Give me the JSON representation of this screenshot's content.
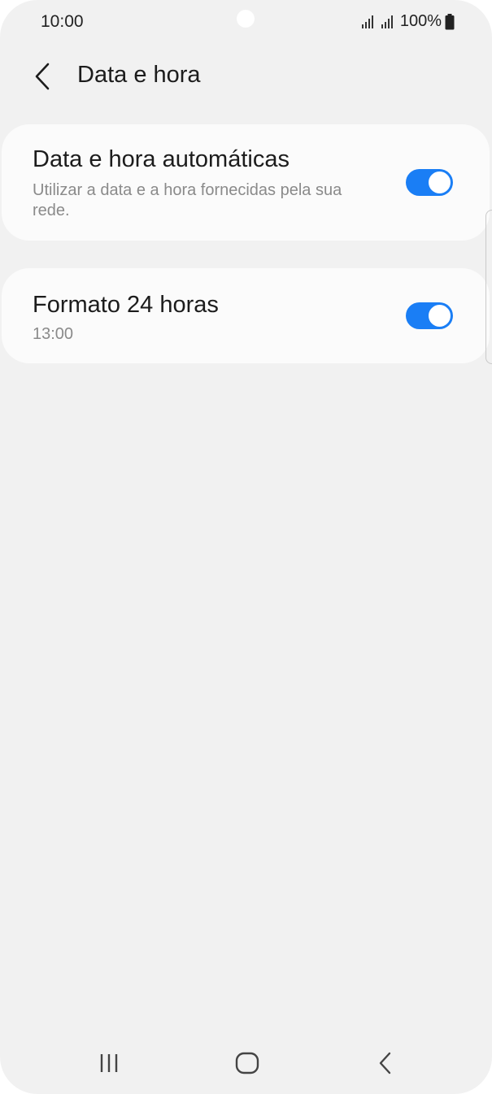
{
  "status_bar": {
    "time": "10:00",
    "battery_text": "100%",
    "icons": [
      "signal-icon",
      "signal-icon",
      "battery-icon"
    ]
  },
  "header": {
    "title": "Data e hora",
    "back_icon": "chevron-left-icon"
  },
  "settings": [
    {
      "title": "Data e hora automáticas",
      "subtitle": "Utilizar a data e a hora fornecidas pela sua rede.",
      "toggle_on": true
    },
    {
      "title": "Formato 24 horas",
      "subtitle": "13:00",
      "toggle_on": true
    }
  ],
  "nav_bar": {
    "icons": [
      "recent-apps-icon",
      "home-icon",
      "back-icon"
    ]
  },
  "colors": {
    "accent": "#1a7ef5",
    "background": "#f1f1f1",
    "card": "#fbfbfb"
  }
}
